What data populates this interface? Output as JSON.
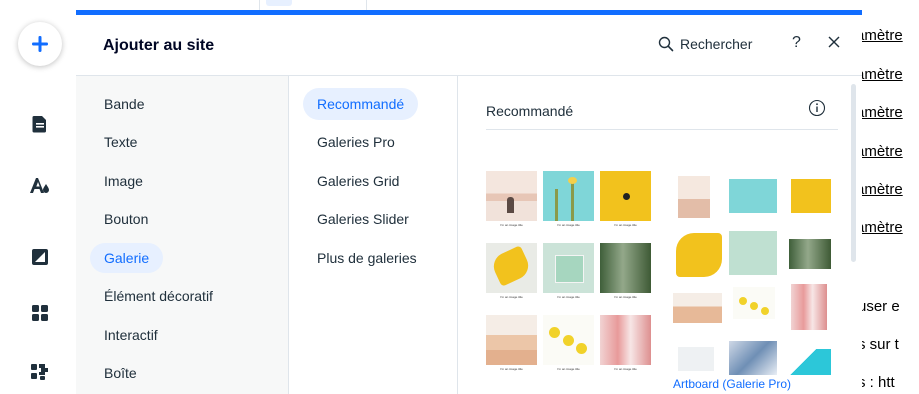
{
  "panel": {
    "title": "Ajouter au site",
    "search_label": "Rechercher",
    "help_label": "?"
  },
  "toolbar": {
    "items": [
      {
        "icon": "plus-icon"
      },
      {
        "icon": "page-icon"
      },
      {
        "icon": "theme-icon"
      },
      {
        "icon": "background-icon"
      },
      {
        "icon": "apps-icon"
      },
      {
        "icon": "puzzle-icon"
      }
    ]
  },
  "categories": [
    {
      "label": "Bande"
    },
    {
      "label": "Texte"
    },
    {
      "label": "Image"
    },
    {
      "label": "Bouton"
    },
    {
      "label": "Galerie",
      "active": true
    },
    {
      "label": "Élément décoratif"
    },
    {
      "label": "Interactif"
    },
    {
      "label": "Boîte"
    }
  ],
  "subcategories": [
    {
      "label": "Recommandé",
      "active": true
    },
    {
      "label": "Galeries Pro"
    },
    {
      "label": "Galeries Grid"
    },
    {
      "label": "Galeries Slider"
    },
    {
      "label": "Plus de galeries"
    }
  ],
  "content": {
    "section_title": "Recommandé",
    "gallery_caption": "Artboard (Galerie Pro)",
    "thumb_caption": "I'm an image title",
    "thumb_subcaption": "Describe your image here"
  },
  "background_page": {
    "links": [
      "amètre",
      "amètre",
      "amètre",
      "amètre",
      "amètre",
      "amètre"
    ],
    "lines": [
      "user e",
      "s sur t",
      "s : htt"
    ]
  },
  "colors": {
    "accent": "#116dff",
    "accent_bg": "#e7f0ff"
  }
}
